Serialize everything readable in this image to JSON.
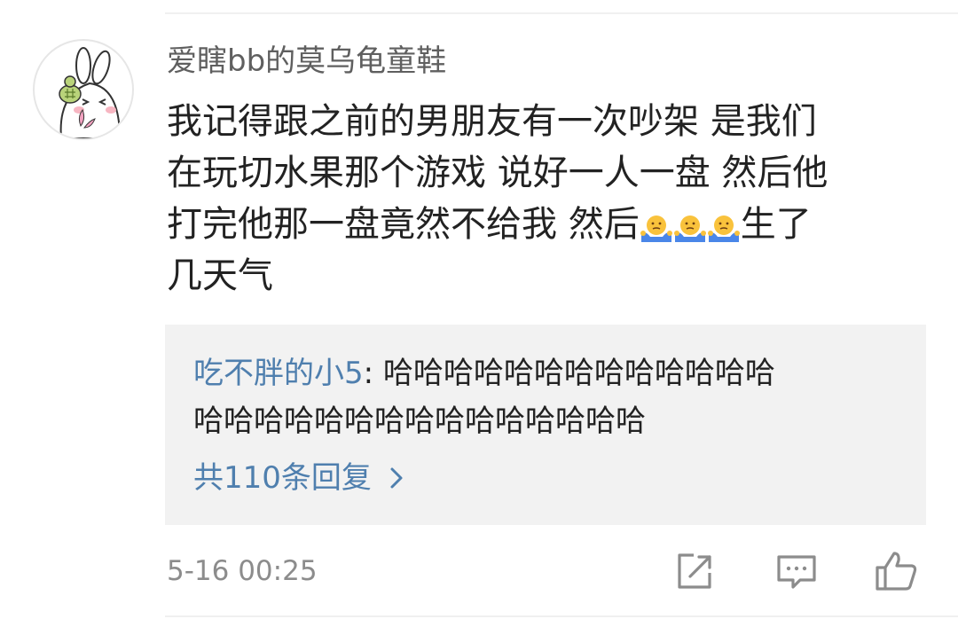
{
  "comment": {
    "username": "爱瞎bb的莫乌龟童鞋",
    "avatar_icon": "bunny-holding-turtle-avatar",
    "content_lines": [
      "我记得跟之前的男朋友有一次吵架 是我们",
      "在玩切水果那个游戏 说好一人一盘 然后他",
      "打完他那一盘竟然不给我 然后",
      "几天气"
    ],
    "content_line3_tail": "生了",
    "emojis": [
      "shrug-emoji",
      "shrug-emoji",
      "shrug-emoji"
    ],
    "timestamp": "5-16 00:25"
  },
  "reply_preview": {
    "author": "吃不胖的小5",
    "separator": ": ",
    "text_line1": "哈哈哈哈哈哈哈哈哈哈哈哈哈",
    "text_line2": "哈哈哈哈哈哈哈哈哈哈哈哈哈哈哈",
    "more_replies_label": "共110条回复"
  },
  "actions": {
    "share_icon": "share-icon",
    "comment_icon": "comment-icon",
    "like_icon": "thumbs-up-icon"
  },
  "colors": {
    "link_blue": "#4f7fae",
    "text_primary": "#222222",
    "text_secondary": "#8c8c8c",
    "reply_background": "#f2f2f2",
    "emoji_yellow": "#f9c23c",
    "emoji_hand_blue": "#4a86e8"
  }
}
